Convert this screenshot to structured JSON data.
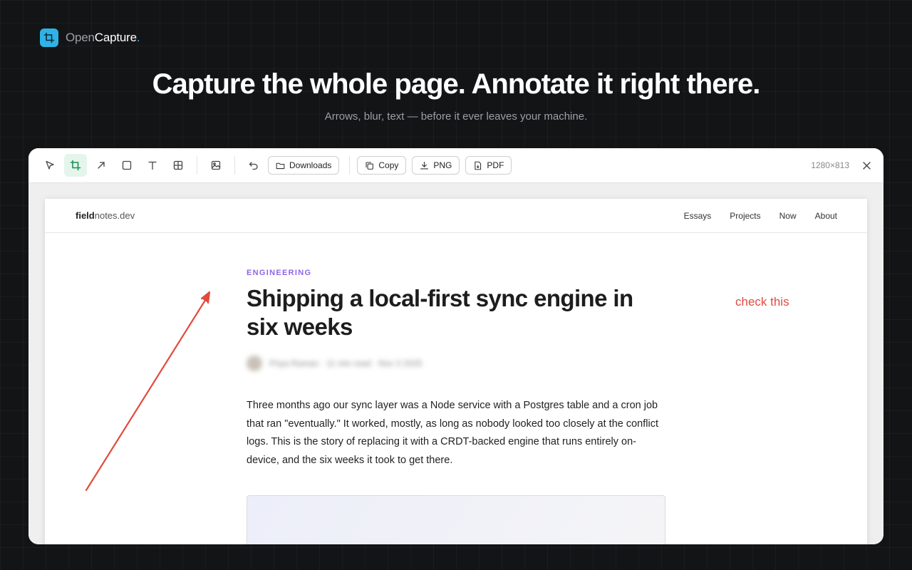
{
  "brand": {
    "name_part1": "Open",
    "name_part2": "Capture",
    "dot": "."
  },
  "hero": {
    "headline": "Capture the whole page. Annotate it right there.",
    "subline": "Arrows, blur, text — before it ever leaves your machine."
  },
  "toolbar": {
    "tools": [
      "select",
      "crop",
      "arrow",
      "rectangle",
      "text",
      "grid",
      "image"
    ],
    "active_tool": "crop",
    "downloads_label": "Downloads",
    "copy_label": "Copy",
    "png_label": "PNG",
    "pdf_label": "PDF",
    "dimensions": "1280×813"
  },
  "site": {
    "logo_bold": "field",
    "logo_rest": "notes.dev",
    "nav": [
      "Essays",
      "Projects",
      "Now",
      "About"
    ]
  },
  "article": {
    "category": "ENGINEERING",
    "title": "Shipping a local-first sync engine in six weeks",
    "byline": "Priya Raman · 11 min read · Nov 3 2025",
    "body": "Three months ago our sync layer was a Node service with a Postgres table and a cron job that ran \"eventually.\" It worked, mostly, as long as nobody looked too closely at the conflict logs. This is the story of replacing it with a CRDT-backed engine that runs entirely on-device, and the six weeks it took to get there."
  },
  "annotations": {
    "text": "check this",
    "color": "#e14a3e"
  },
  "colors": {
    "accent": "#2fb3e6",
    "active_tool_bg": "#e4f5ec",
    "category": "#8f66e6"
  }
}
